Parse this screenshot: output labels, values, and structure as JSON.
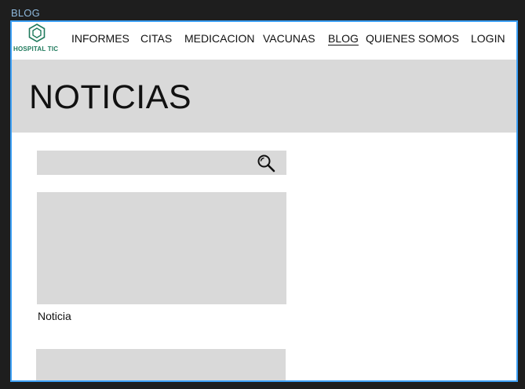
{
  "frame": {
    "label": "BLOG"
  },
  "logo": {
    "text": "HOSPITAL TIC",
    "color": "#1f7a5c",
    "icon": "hexagon-icon"
  },
  "nav": {
    "items": [
      {
        "label": "INFORMES",
        "active": false
      },
      {
        "label": "CITAS",
        "active": false
      },
      {
        "label": "MEDICACION",
        "active": false
      },
      {
        "label": "VACUNAS",
        "active": false
      },
      {
        "label": "BLOG",
        "active": true
      },
      {
        "label": "QUIENES SOMOS",
        "active": false
      },
      {
        "label": "LOGIN",
        "active": false
      }
    ]
  },
  "hero": {
    "title": "NOTICIAS"
  },
  "search": {
    "placeholder": "",
    "icon": "search-icon"
  },
  "news": [
    {
      "caption": "Noticia"
    }
  ],
  "colors": {
    "background": "#1e1e1e",
    "frame_border": "#3da0f5",
    "placeholder_gray": "#d9d9d9"
  }
}
